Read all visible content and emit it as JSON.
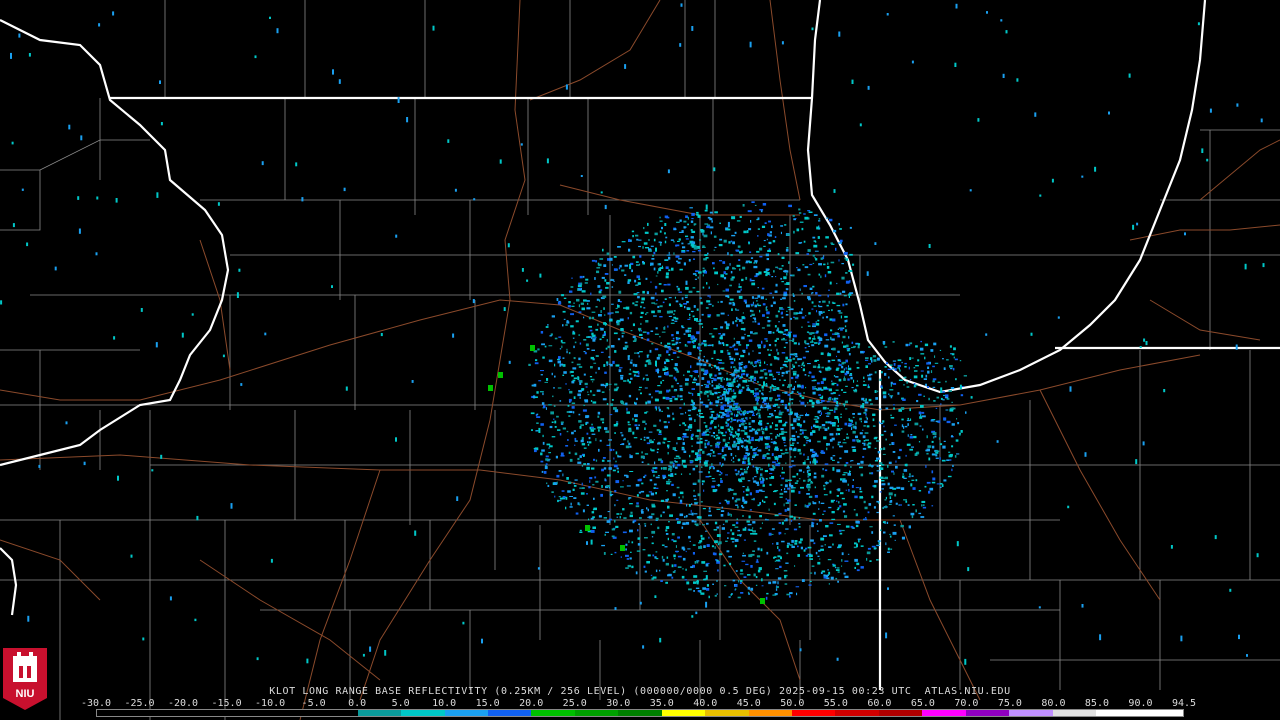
{
  "caption": "KLOT LONG RANGE BASE REFLECTIVITY (0.25KM / 256 LEVEL) (000000/0000 0.5 DEG) 2025-09-15 00:23 UTC  ATLAS.NIU.EDU",
  "logo": {
    "text": "NIU",
    "colors": {
      "background": "#c8102e",
      "foreground": "#ffffff"
    }
  },
  "colorbar": {
    "ticks": [
      "-30.0",
      "-25.0",
      "-20.0",
      "-15.0",
      "-10.0",
      "-5.0",
      "0.0",
      "5.0",
      "10.0",
      "15.0",
      "20.0",
      "25.0",
      "30.0",
      "35.0",
      "40.0",
      "45.0",
      "50.0",
      "55.0",
      "60.0",
      "65.0",
      "70.0",
      "75.0",
      "80.0",
      "85.0",
      "90.0",
      "94.5"
    ],
    "colors": [
      "#000000",
      "#000000",
      "#000000",
      "#000000",
      "#000000",
      "#000000",
      "#0a9a9a",
      "#00c8c8",
      "#1aa0f0",
      "#1060f0",
      "#00c000",
      "#00a000",
      "#008000",
      "#ffff00",
      "#e8c000",
      "#ff9000",
      "#ff0000",
      "#d00000",
      "#b00000",
      "#ff00ff",
      "#9000c0",
      "#c090ff",
      "#e0e0e0",
      "#ffffff",
      "#ffffff"
    ]
  },
  "map_colors": {
    "background": "#000000",
    "state_borders": "#ffffff",
    "county_lines": "#8a8a8a",
    "rivers_roads": "#8b4a2b"
  },
  "radar": {
    "site": "KLOT"
  }
}
